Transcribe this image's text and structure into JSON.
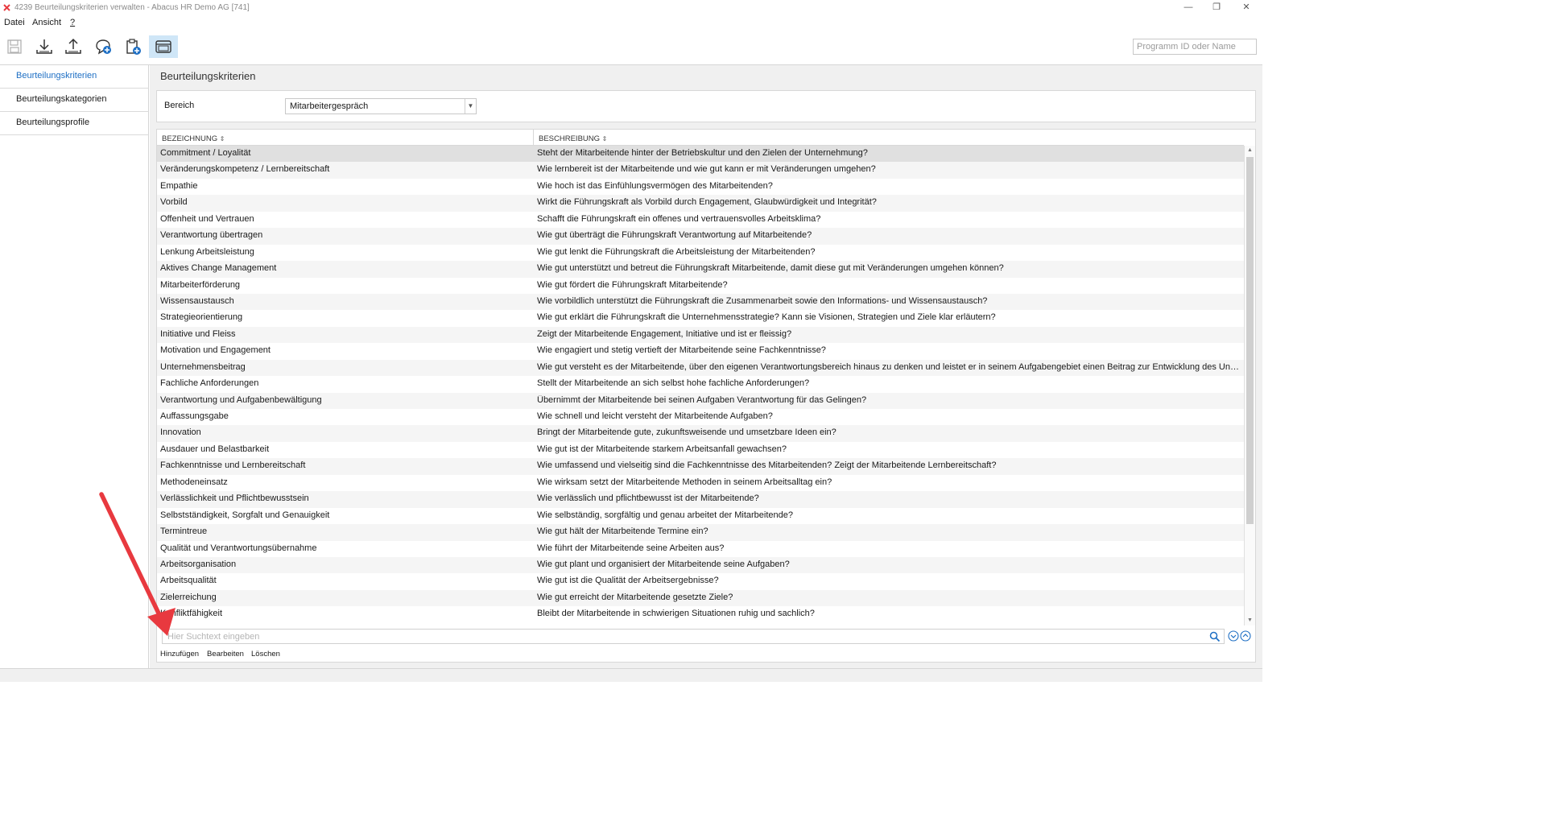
{
  "window": {
    "title": "4239 Beurteilungskriterien verwalten - Abacus HR Demo AG [741]",
    "controls": [
      "—",
      "❐",
      "✕"
    ]
  },
  "menu": [
    "Datei",
    "Ansicht",
    "?"
  ],
  "toolbar": {
    "icons": [
      "save-icon",
      "download-icon",
      "upload-icon",
      "chat-add-icon",
      "clipboard-add-icon",
      "window-icon"
    ],
    "program_search_placeholder": "Programm ID oder Name"
  },
  "sidebar": {
    "items": [
      {
        "label": "Beurteilungskriterien",
        "active": true
      },
      {
        "label": "Beurteilungskategorien",
        "active": false
      },
      {
        "label": "Beurteilungsprofile",
        "active": false
      }
    ]
  },
  "main": {
    "title": "Beurteilungskriterien",
    "bereich_label": "Bereich",
    "bereich_value": "Mitarbeitergespräch",
    "columns": [
      "BEZEICHNUNG",
      "BESCHREIBUNG"
    ],
    "rows": [
      {
        "name": "Commitment / Loyalität",
        "desc": "Steht der Mitarbeitende hinter der Betriebskultur und den Zielen der Unternehmung?"
      },
      {
        "name": "Veränderungskompetenz / Lernbereitschaft",
        "desc": "Wie lernbereit ist der Mitarbeitende und wie gut kann er mit Veränderungen umgehen?"
      },
      {
        "name": "Empathie",
        "desc": "Wie hoch ist das Einfühlungsvermögen des Mitarbeitenden?"
      },
      {
        "name": "Vorbild",
        "desc": "Wirkt die Führungskraft als Vorbild durch Engagement, Glaubwürdigkeit und Integrität?"
      },
      {
        "name": "Offenheit und Vertrauen",
        "desc": "Schafft die Führungskraft ein offenes und vertrauensvolles Arbeitsklima?"
      },
      {
        "name": "Verantwortung übertragen",
        "desc": "Wie gut überträgt die Führungskraft Verantwortung auf Mitarbeitende?"
      },
      {
        "name": "Lenkung Arbeitsleistung",
        "desc": "Wie gut lenkt die Führungskraft die Arbeitsleistung der Mitarbeitenden?"
      },
      {
        "name": "Aktives Change Management",
        "desc": "Wie gut unterstützt und betreut die Führungskraft Mitarbeitende, damit diese gut mit Veränderungen umgehen können?"
      },
      {
        "name": "Mitarbeiterförderung",
        "desc": "Wie gut fördert die Führungskraft Mitarbeitende?"
      },
      {
        "name": "Wissensaustausch",
        "desc": "Wie vorbildlich unterstützt die Führungskraft die Zusammenarbeit sowie den Informations- und Wissensaustausch?"
      },
      {
        "name": "Strategieorientierung",
        "desc": "Wie gut erklärt die Führungskraft die Unternehmensstrategie? Kann sie Visionen, Strategien und Ziele klar erläutern?"
      },
      {
        "name": "Initiative und Fleiss",
        "desc": "Zeigt der Mitarbeitende Engagement, Initiative und ist er fleissig?"
      },
      {
        "name": "Motivation und Engagement",
        "desc": "Wie engagiert und stetig vertieft der Mitarbeitende seine Fachkenntnisse?"
      },
      {
        "name": "Unternehmensbeitrag",
        "desc": "Wie gut versteht es der Mitarbeitende, über den eigenen Verantwortungsbereich hinaus zu denken und leistet er in seinem Aufgabengebiet einen Beitrag zur Entwicklung des Unternehmens?"
      },
      {
        "name": "Fachliche Anforderungen",
        "desc": "Stellt der Mitarbeitende an sich selbst hohe fachliche Anforderungen?"
      },
      {
        "name": "Verantwortung und Aufgabenbewältigung",
        "desc": "Übernimmt der Mitarbeitende bei seinen Aufgaben Verantwortung für das Gelingen?"
      },
      {
        "name": "Auffassungsgabe",
        "desc": "Wie schnell und leicht versteht der Mitarbeitende Aufgaben?"
      },
      {
        "name": "Innovation",
        "desc": "Bringt der Mitarbeitende gute, zukunftsweisende und umsetzbare Ideen ein?"
      },
      {
        "name": "Ausdauer und Belastbarkeit",
        "desc": "Wie gut ist der Mitarbeitende starkem Arbeitsanfall gewachsen?"
      },
      {
        "name": "Fachkenntnisse und Lernbereitschaft",
        "desc": "Wie umfassend und vielseitig sind die Fachkenntnisse des Mitarbeitenden? Zeigt der Mitarbeitende Lernbereitschaft?"
      },
      {
        "name": "Methodeneinsatz",
        "desc": "Wie wirksam setzt der Mitarbeitende Methoden in seinem Arbeitsalltag ein?"
      },
      {
        "name": "Verlässlichkeit und Pflichtbewusstsein",
        "desc": "Wie verlässlich und pflichtbewusst ist der Mitarbeitende?"
      },
      {
        "name": "Selbstständigkeit, Sorgfalt und Genauigkeit",
        "desc": "Wie selbständig, sorgfältig und genau arbeitet der Mitarbeitende?"
      },
      {
        "name": "Termintreue",
        "desc": "Wie gut hält der Mitarbeitende Termine ein?"
      },
      {
        "name": "Qualität und Verantwortungsübernahme",
        "desc": "Wie führt der Mitarbeitende seine Arbeiten aus?"
      },
      {
        "name": "Arbeitsorganisation",
        "desc": "Wie gut plant und organisiert der Mitarbeitende seine Aufgaben?"
      },
      {
        "name": "Arbeitsqualität",
        "desc": "Wie gut ist die Qualität der Arbeitsergebnisse?"
      },
      {
        "name": "Zielerreichung",
        "desc": "Wie gut erreicht der Mitarbeitende gesetzte Ziele?"
      },
      {
        "name": "Konfliktfähigkeit",
        "desc": "Bleibt der Mitarbeitende in schwierigen Situationen ruhig und sachlich?"
      }
    ],
    "search_placeholder": "Hier Suchtext eingeben",
    "actions": [
      "Hinzufügen",
      "Bearbeiten",
      "Löschen"
    ]
  },
  "colors": {
    "accent": "#1e6fc4",
    "annotation_arrow": "#e8393f",
    "selected_row": "#e0e0e0"
  }
}
